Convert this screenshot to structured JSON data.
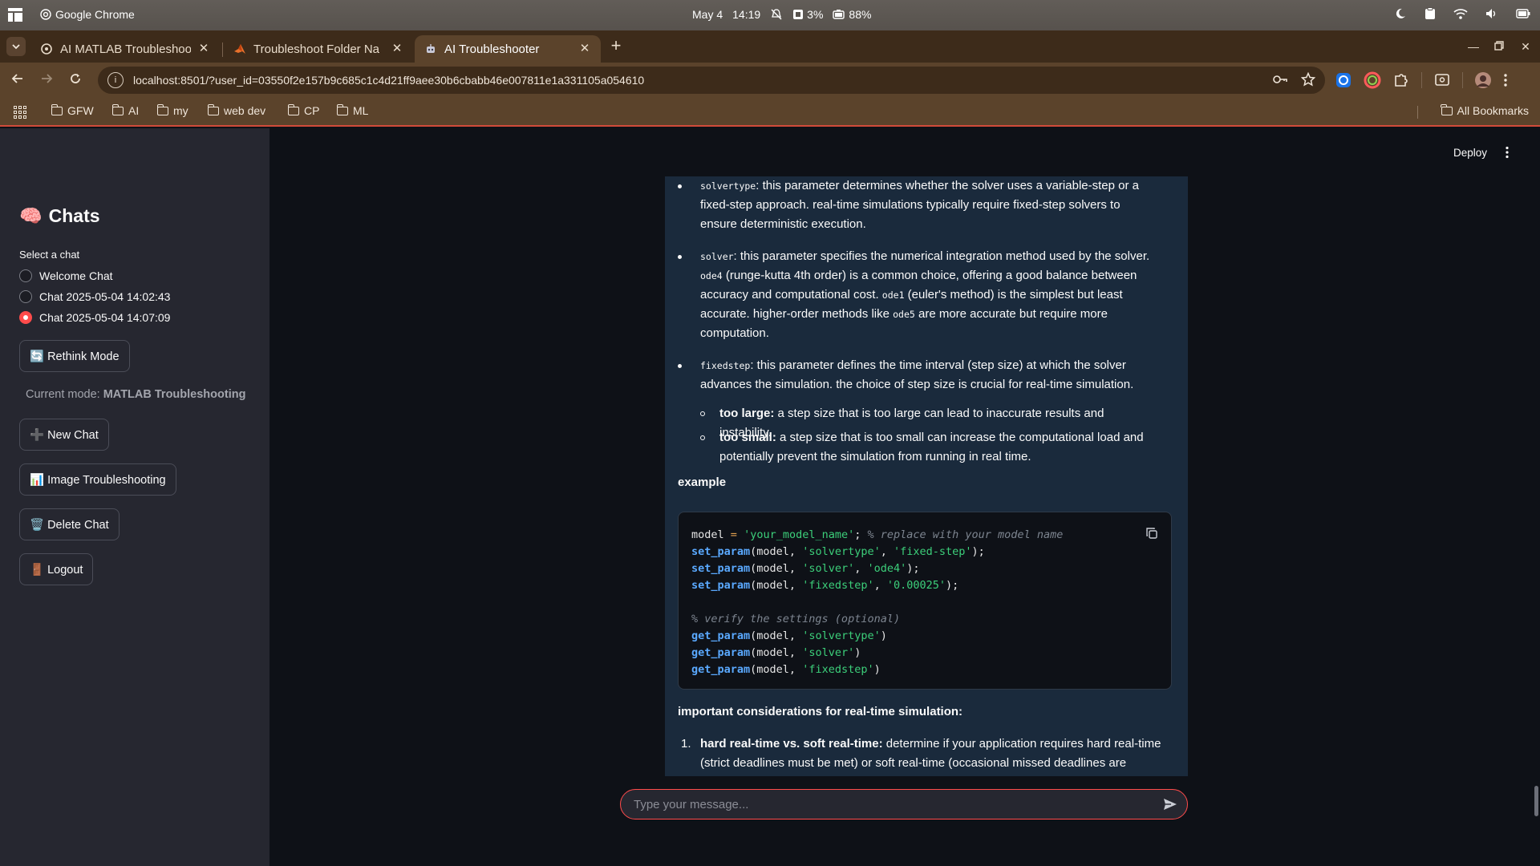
{
  "os": {
    "app_name": "Google Chrome",
    "date": "May 4",
    "time": "14:19",
    "cpu": "3%",
    "battery": "88%"
  },
  "tabs": [
    {
      "title": "AI MATLAB Troubleshoo",
      "icon": "streamlit-icon"
    },
    {
      "title": "Troubleshoot Folder Na",
      "icon": "matlab-icon"
    },
    {
      "title": "AI Troubleshooter",
      "icon": "robot-icon"
    }
  ],
  "address": {
    "url": "localhost:8501/?user_id=03550f2e157b9c685c1c4d21ff9aee30b6cbabb46e007811e1a331105a054610"
  },
  "bookmarks": {
    "items": [
      "GFW",
      "AI",
      "my",
      "web dev",
      "CP",
      "ML"
    ],
    "all_label": "All Bookmarks"
  },
  "sidebar": {
    "title_emoji": "🧠",
    "title": "Chats",
    "select_label": "Select a chat",
    "chats": [
      {
        "label": "Welcome Chat",
        "selected": false
      },
      {
        "label": "Chat 2025-05-04 14:02:43",
        "selected": false
      },
      {
        "label": "Chat 2025-05-04 14:07:09",
        "selected": true
      }
    ],
    "rethink_button": "🔄 Rethink Mode",
    "mode_prefix": "Current mode: ",
    "mode_value": "MATLAB Troubleshooting",
    "new_chat_button": "➕ New Chat",
    "image_button": "📊 Image Troubleshooting",
    "delete_button": "🗑️ Delete Chat",
    "logout_button": "🚪 Logout"
  },
  "header": {
    "deploy_label": "Deploy"
  },
  "message": {
    "b1_code": "solvertype",
    "b1_text": ": this parameter determines whether the solver uses a variable-step or a fixed-step approach. real-time simulations typically require fixed-step solvers to ensure deterministic execution.",
    "b2_code": "solver",
    "b2_text1": ": this parameter specifies the numerical integration method used by the solver. ",
    "b2_code2": "ode4",
    "b2_text2": " (runge-kutta 4th order) is a common choice, offering a good balance between accuracy and computational cost. ",
    "b2_code3": "ode1",
    "b2_text3": " (euler's method) is the simplest but least accurate. higher-order methods like ",
    "b2_code4": "ode5",
    "b2_text4": " are more accurate but require more computation.",
    "b3_code": "fixedstep",
    "b3_text": ": this parameter defines the time interval (step size) at which the solver advances the simulation. the choice of step size is crucial for real-time simulation.",
    "s1_bold": "too large:",
    "s1_text": " a step size that is too large can lead to inaccurate results and instability.",
    "s2_bold": "too small:",
    "s2_text": " a step size that is too small can increase the computational load and potentially prevent the simulation from running in real time.",
    "example_heading": "example",
    "code_lines": [
      "model = 'your_model_name'; % replace with your model name",
      "set_param(model, 'solvertype', 'fixed-step');",
      "set_param(model, 'solver', 'ode4');",
      "set_param(model, 'fixedstep', '0.00025');",
      "",
      "% verify the settings (optional)",
      "get_param(model, 'solvertype')",
      "get_param(model, 'solver')",
      "get_param(model, 'fixedstep')"
    ],
    "considerations_heading": "important considerations for real-time simulation:",
    "n1_num": "1.",
    "n1_bold": "hard real-time vs. soft real-time:",
    "n1_text": " determine if your application requires hard real-time (strict deadlines must be met) or soft real-time (occasional missed deadlines are"
  },
  "chat_input": {
    "placeholder": "Type your message..."
  },
  "colors": {
    "accent": "#ff4b4b",
    "sidebar_bg": "#262730",
    "main_bg": "#0e1117",
    "message_bg": "#1a2a3c"
  }
}
